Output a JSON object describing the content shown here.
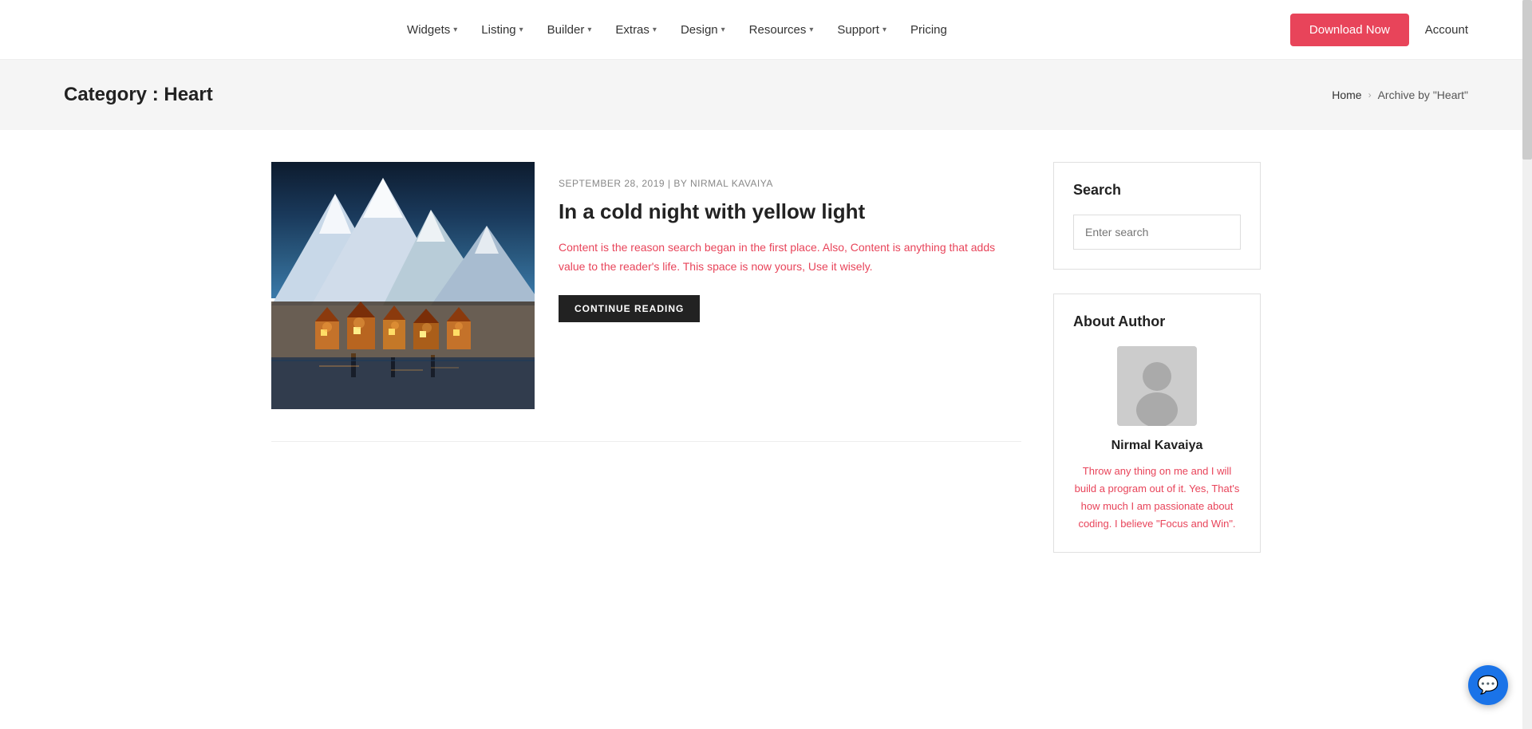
{
  "header": {
    "nav_items": [
      {
        "label": "Widgets",
        "has_dropdown": true
      },
      {
        "label": "Listing",
        "has_dropdown": true
      },
      {
        "label": "Builder",
        "has_dropdown": true
      },
      {
        "label": "Extras",
        "has_dropdown": true
      },
      {
        "label": "Design",
        "has_dropdown": true
      },
      {
        "label": "Resources",
        "has_dropdown": true
      },
      {
        "label": "Support",
        "has_dropdown": true
      },
      {
        "label": "Pricing",
        "has_dropdown": false
      }
    ],
    "download_btn": "Download Now",
    "account_label": "Account"
  },
  "breadcrumb": {
    "prefix": "Category : ",
    "category": "Heart",
    "home_label": "Home",
    "archive_label": "Archive by \"Heart\""
  },
  "post": {
    "meta": "SEPTEMBER 28, 2019 | BY NIRMAL KAVAIYA",
    "title": "In a cold night with yellow light",
    "excerpt": "Content is the reason search began in the first place. Also, Content is anything that adds value to the reader's life. This space is now yours, Use it wisely.",
    "continue_btn": "CONTINUE READING"
  },
  "sidebar": {
    "search_title": "Search",
    "search_placeholder": "Enter search",
    "author_title": "About Author",
    "author_name": "Nirmal Kavaiya",
    "author_bio": "Throw any thing on me and I will build a program out of it. Yes, That's how much I am passionate about coding. I believe \"Focus and Win\"."
  },
  "colors": {
    "accent": "#e8445a",
    "dark": "#222222",
    "light_bg": "#f5f5f5"
  }
}
